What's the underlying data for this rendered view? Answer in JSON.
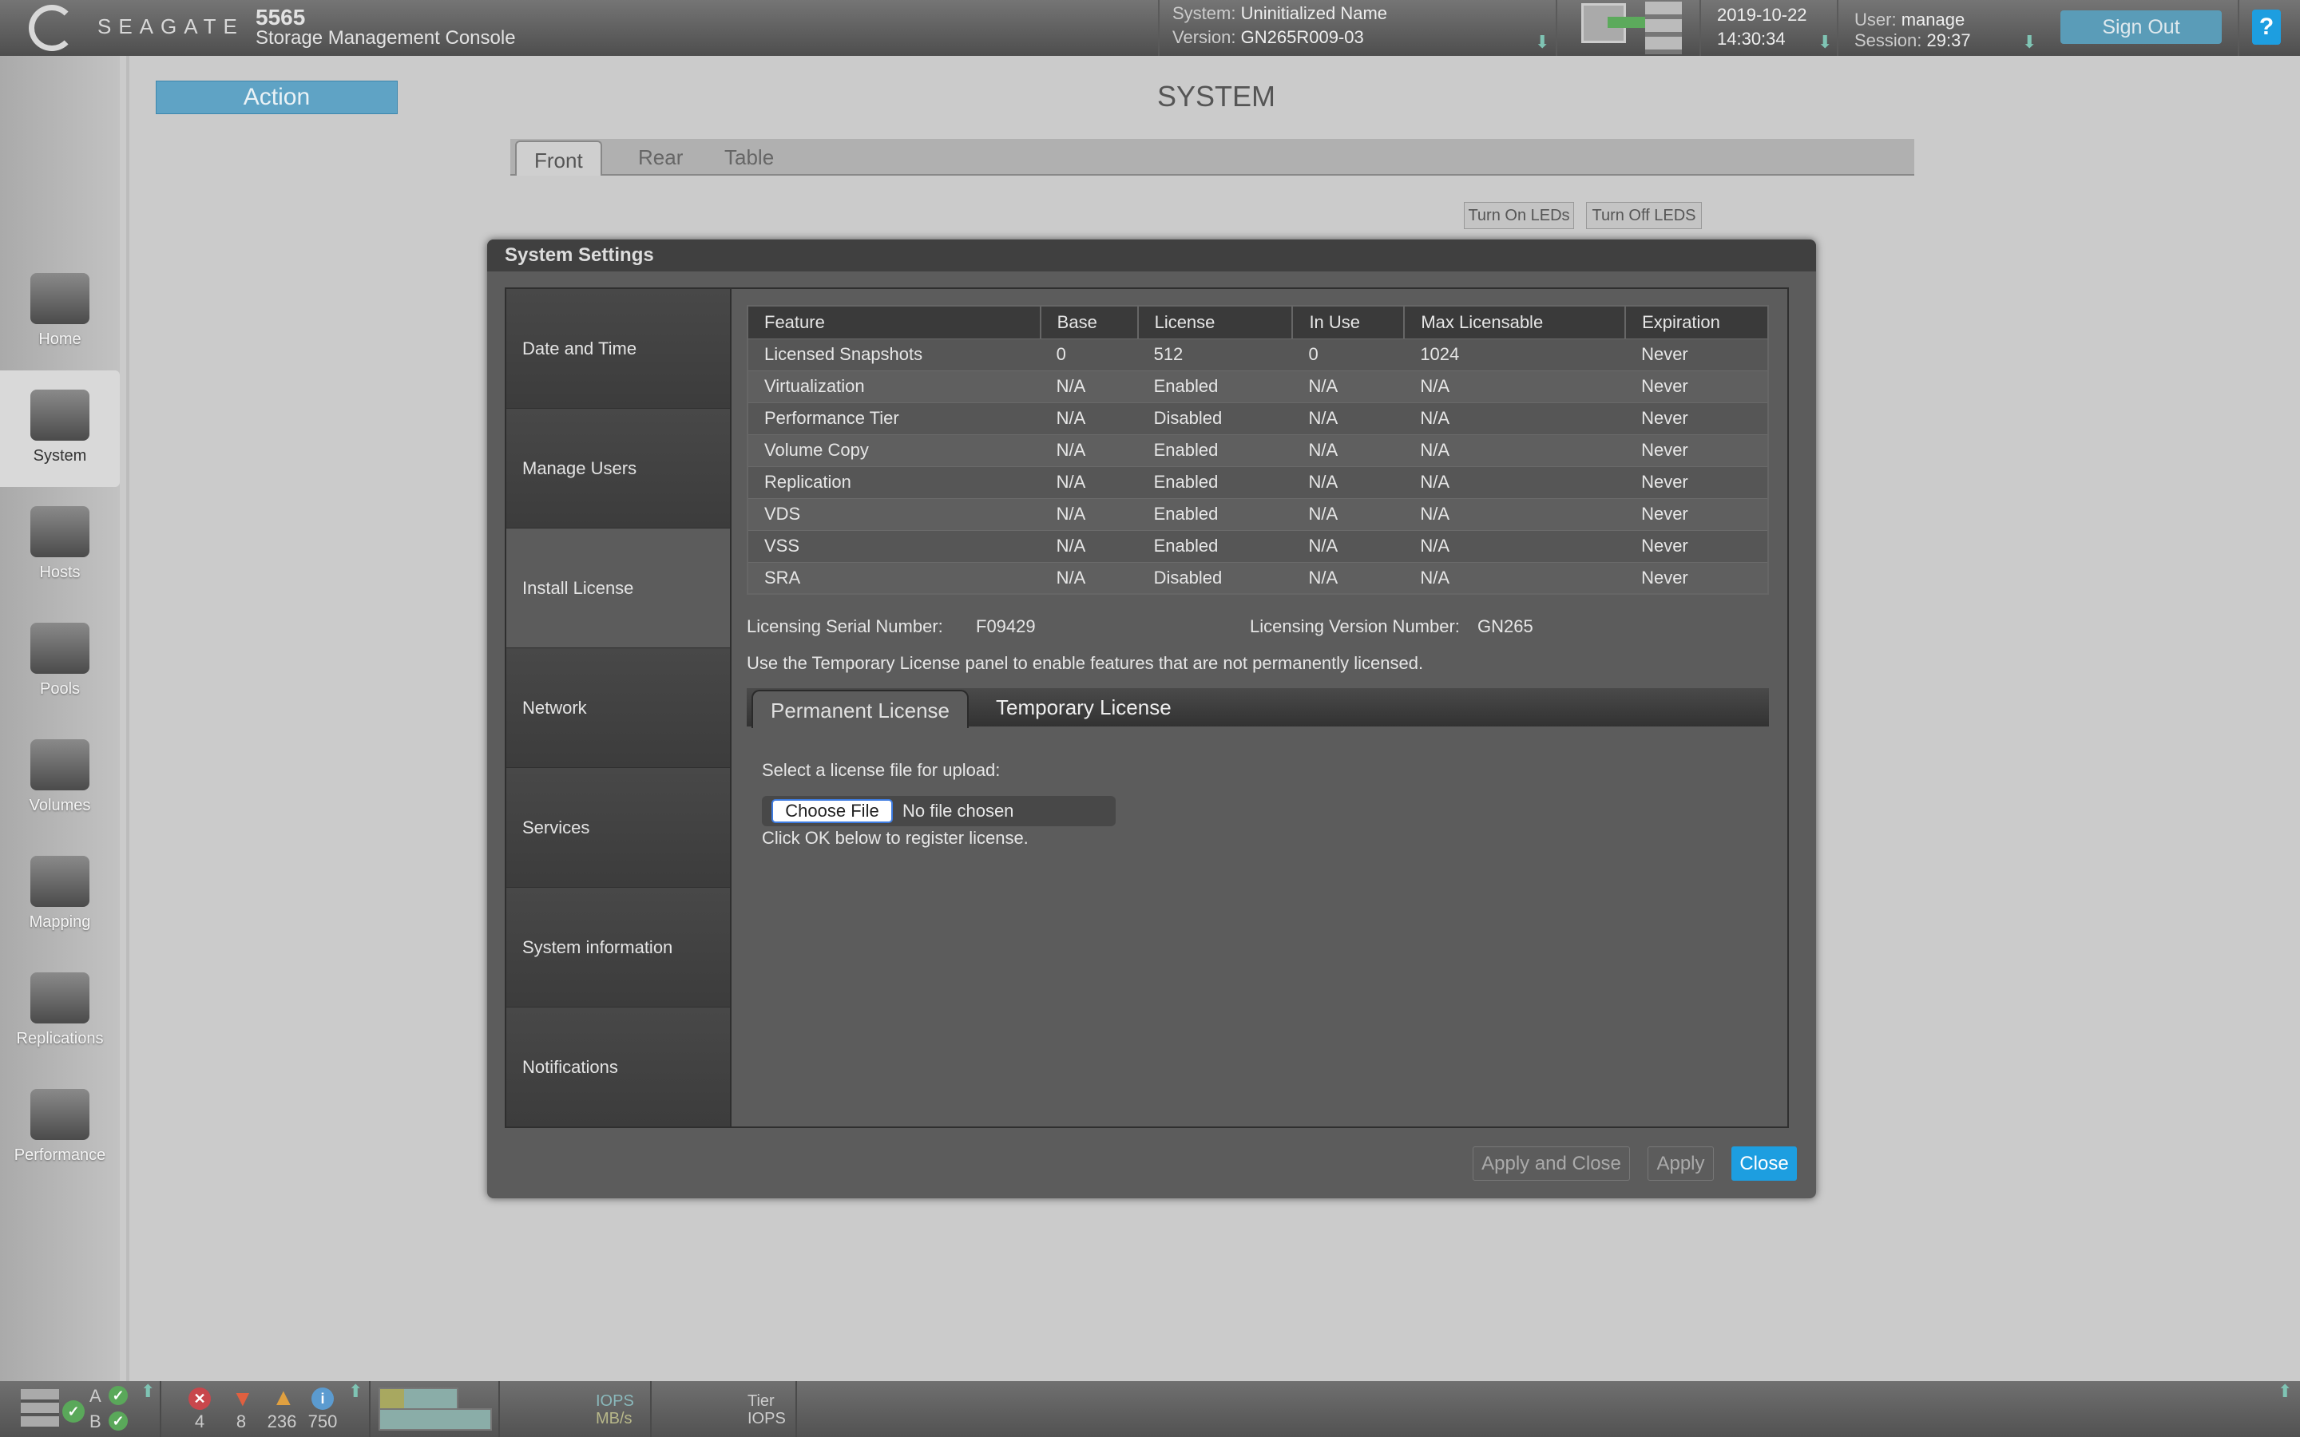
{
  "header": {
    "brand": "SEAGATE",
    "model": "5565",
    "product": "Storage Management Console",
    "system_label": "System:",
    "system_value": "Uninitialized Name",
    "version_label": "Version:",
    "version_value": "GN265R009-03",
    "date": "2019-10-22",
    "time": "14:30:34",
    "user_label": "User:",
    "user_value": "manage",
    "session_label": "Session:",
    "session_value": "29:37",
    "sign_out": "Sign Out",
    "help": "?"
  },
  "sidebar": {
    "items": [
      {
        "label": "Home",
        "icon": "home-icon"
      },
      {
        "label": "System",
        "icon": "system-icon",
        "active": true
      },
      {
        "label": "Hosts",
        "icon": "hosts-icon"
      },
      {
        "label": "Pools",
        "icon": "pools-icon"
      },
      {
        "label": "Volumes",
        "icon": "volumes-icon"
      },
      {
        "label": "Mapping",
        "icon": "mapping-icon"
      },
      {
        "label": "Replications",
        "icon": "replications-icon"
      },
      {
        "label": "Performance",
        "icon": "performance-icon"
      }
    ]
  },
  "main": {
    "action": "Action",
    "title": "SYSTEM",
    "tabs": [
      "Front",
      "Rear",
      "Table"
    ],
    "leds_on": "Turn On LEDs",
    "leds_off": "Turn Off LEDS"
  },
  "modal": {
    "title": "System Settings",
    "nav": [
      "Date and Time",
      "Manage Users",
      "Install License",
      "Network",
      "Services",
      "System information",
      "Notifications"
    ],
    "table": {
      "headers": [
        "Feature",
        "Base",
        "License",
        "In Use",
        "Max Licensable",
        "Expiration"
      ],
      "rows": [
        [
          "Licensed Snapshots",
          "0",
          "512",
          "0",
          "1024",
          "Never"
        ],
        [
          "Virtualization",
          "N/A",
          "Enabled",
          "N/A",
          "N/A",
          "Never"
        ],
        [
          "Performance Tier",
          "N/A",
          "Disabled",
          "N/A",
          "N/A",
          "Never"
        ],
        [
          "Volume Copy",
          "N/A",
          "Enabled",
          "N/A",
          "N/A",
          "Never"
        ],
        [
          "Replication",
          "N/A",
          "Enabled",
          "N/A",
          "N/A",
          "Never"
        ],
        [
          "VDS",
          "N/A",
          "Enabled",
          "N/A",
          "N/A",
          "Never"
        ],
        [
          "VSS",
          "N/A",
          "Enabled",
          "N/A",
          "N/A",
          "Never"
        ],
        [
          "SRA",
          "N/A",
          "Disabled",
          "N/A",
          "N/A",
          "Never"
        ]
      ]
    },
    "serial_label": "Licensing Serial Number:",
    "serial_value": "F09429",
    "version_label": "Licensing Version Number:",
    "version_value": "GN265",
    "temp_note": "Use the Temporary License panel to enable features that are not permanently licensed.",
    "license_tabs": [
      "Permanent License",
      "Temporary License"
    ],
    "select_prompt": "Select a license file for upload:",
    "choose_file": "Choose File",
    "no_file": "No file chosen",
    "register_note": "Click OK below to register license.",
    "buttons": {
      "apply_close": "Apply and Close",
      "apply": "Apply",
      "close": "Close"
    }
  },
  "statusbar": {
    "controller_a": "A",
    "controller_b": "B",
    "errors": "4",
    "critical": "8",
    "warnings": "236",
    "info": "750",
    "iops": "IOPS",
    "mbs": "MB/s",
    "tier": "Tier",
    "tier_iops": "IOPS"
  },
  "colors": {
    "accent": "#1d9ee0",
    "action": "#5fa3c5",
    "ok": "#5aa85a"
  }
}
